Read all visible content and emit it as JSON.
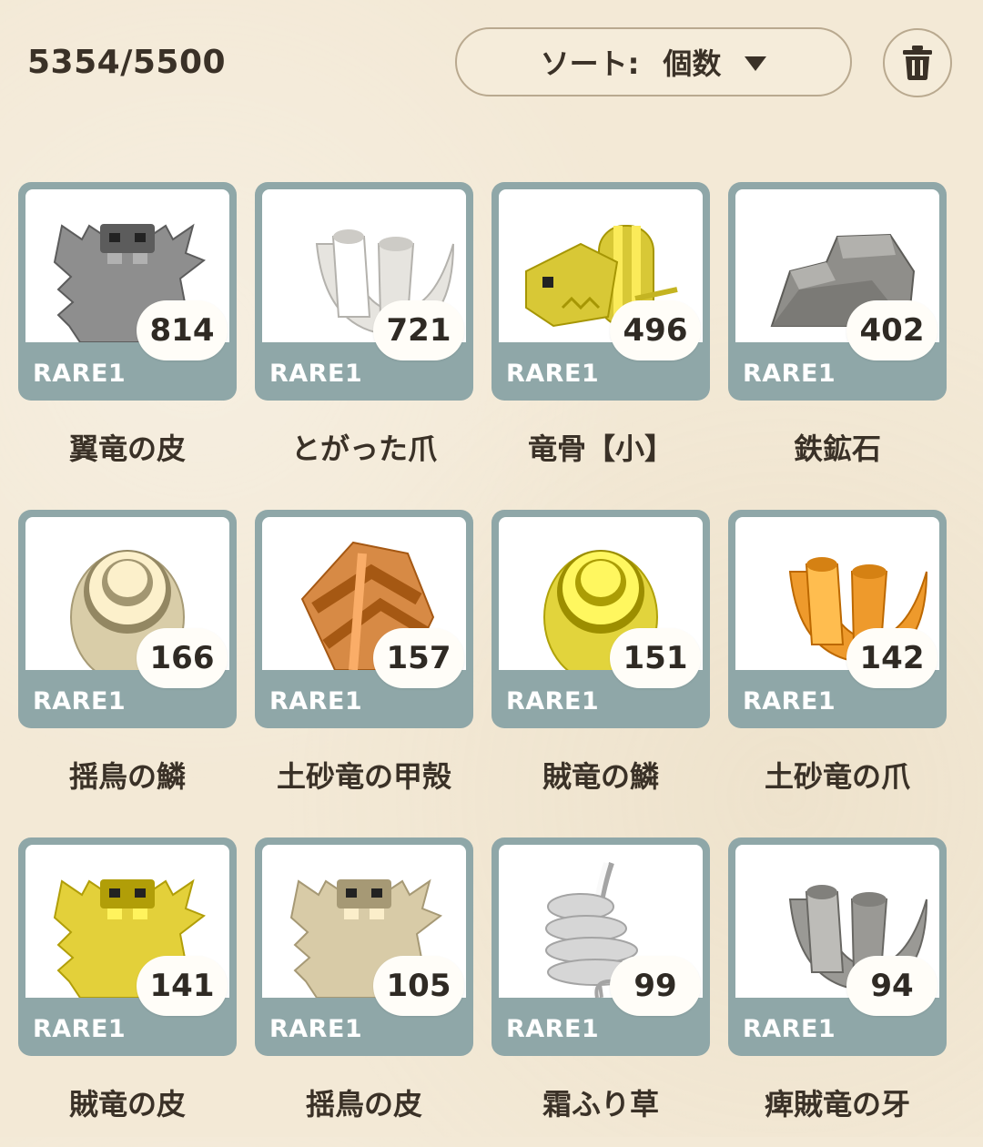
{
  "header": {
    "capacity": "5354/5500",
    "sort_label": "ソート:",
    "sort_value": "個数",
    "trash_icon": "trash-icon"
  },
  "items": [
    {
      "name": "翼竜の皮",
      "count": "814",
      "rarity": "RARE1",
      "icon": "hide-gray-icon",
      "color": "#8e8e8e"
    },
    {
      "name": "とがった爪",
      "count": "721",
      "rarity": "RARE1",
      "icon": "claw-white-icon",
      "color": "#e6e4df"
    },
    {
      "name": "竜骨【小】",
      "count": "496",
      "rarity": "RARE1",
      "icon": "dragon-bone-icon",
      "color": "#d8c836"
    },
    {
      "name": "鉄鉱石",
      "count": "402",
      "rarity": "RARE1",
      "icon": "iron-ore-icon",
      "color": "#8f8e8a"
    },
    {
      "name": "揺鳥の鱗",
      "count": "166",
      "rarity": "RARE1",
      "icon": "scale-beige-icon",
      "color": "#d9cda8"
    },
    {
      "name": "土砂竜の甲殻",
      "count": "157",
      "rarity": "RARE1",
      "icon": "shell-orange-icon",
      "color": "#d78a45"
    },
    {
      "name": "賊竜の鱗",
      "count": "151",
      "rarity": "RARE1",
      "icon": "scale-yellow-icon",
      "color": "#e2d43c"
    },
    {
      "name": "土砂竜の爪",
      "count": "142",
      "rarity": "RARE1",
      "icon": "claw-orange-icon",
      "color": "#ee9a2c"
    },
    {
      "name": "賊竜の皮",
      "count": "141",
      "rarity": "RARE1",
      "icon": "hide-yellow-icon",
      "color": "#e3d03a"
    },
    {
      "name": "揺鳥の皮",
      "count": "105",
      "rarity": "RARE1",
      "icon": "hide-beige-icon",
      "color": "#d8cba7"
    },
    {
      "name": "霜ふり草",
      "count": "99",
      "rarity": "RARE1",
      "icon": "frost-herb-icon",
      "color": "#d6d6d6"
    },
    {
      "name": "痺賊竜の牙",
      "count": "94",
      "rarity": "RARE1",
      "icon": "fang-gray-icon",
      "color": "#9a9995"
    }
  ]
}
